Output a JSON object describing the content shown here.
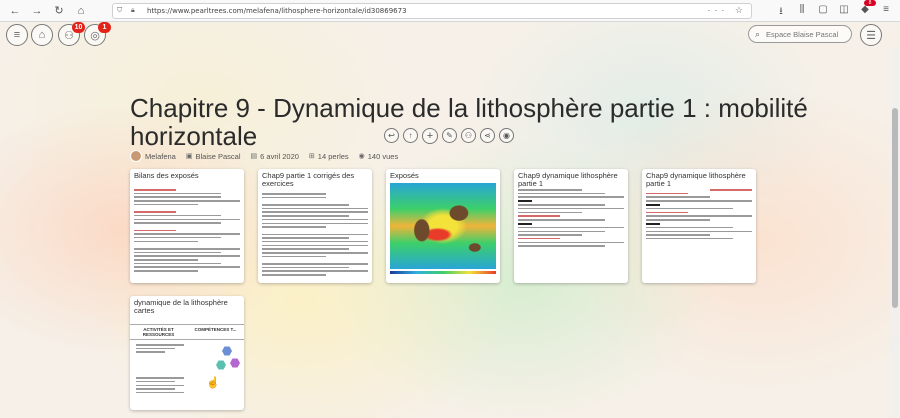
{
  "browser": {
    "url": "https://www.pearltrees.com/melafena/lithosphere-horizontale/id30869673",
    "extension_badge": "8"
  },
  "header": {
    "notifications_badge": "10",
    "alerts_badge": "1",
    "search_placeholder": "Espace Blaise Pascal"
  },
  "collection": {
    "title": "Chapitre 9 - Dynamique de la lithosphère partie 1 : mobilité horizontale",
    "author": "Melafena",
    "team": "Blaise Pascal",
    "date": "6 avril 2020",
    "pearls": "14 perles",
    "views": "140 vues"
  },
  "cards": [
    {
      "title": "Bilans des exposés"
    },
    {
      "title": "Chap9 partie 1 corrigés des exercices"
    },
    {
      "title": "Exposés"
    },
    {
      "title": "Chap9 dynamique lithosphère partie 1"
    },
    {
      "title": "Chap9 dynamique lithosphère partie 1"
    },
    {
      "title": "dynamique de la lithosphère cartes",
      "col1": "ACTIVITÉS ET RESSOURCES",
      "col2": "COMPÉTENCES T..."
    }
  ]
}
